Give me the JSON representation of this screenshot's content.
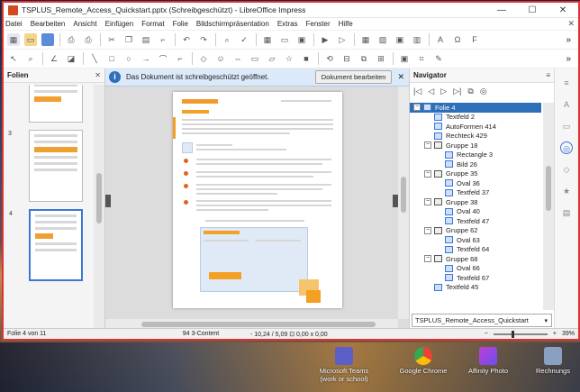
{
  "window": {
    "title": "TSPLUS_Remote_Access_Quickstart.pptx (Schreibgeschützt) - LibreOffice Impress",
    "minimize": "—",
    "maximize": "☐",
    "close": "✕"
  },
  "menu": [
    "Datei",
    "Bearbeiten",
    "Ansicht",
    "Einfügen",
    "Format",
    "Folie",
    "Bildschirmpräsentation",
    "Extras",
    "Fenster",
    "Hilfe"
  ],
  "slides_pane": {
    "title": "Folien",
    "close": "✕",
    "thumb_numbers": [
      "",
      "3",
      "4"
    ]
  },
  "infobar": {
    "icon": "i",
    "message": "Das Dokument ist schreibgeschützt geöffnet.",
    "button": "Dokument bearbeiten",
    "close": "✕"
  },
  "navigator": {
    "title": "Navigator",
    "close": "✕",
    "menu": "≡",
    "tree": [
      {
        "label": "Folie 4",
        "level": 0,
        "expand": "−",
        "selected": true,
        "kind": "slide"
      },
      {
        "label": "Textfeld 2",
        "level": 1,
        "kind": "shape"
      },
      {
        "label": "AutoFormen 414",
        "level": 1,
        "kind": "shape"
      },
      {
        "label": "Rechteck 429",
        "level": 1,
        "kind": "shape"
      },
      {
        "label": "Gruppe 18",
        "level": 1,
        "expand": "−",
        "kind": "group"
      },
      {
        "label": "Rectangle 3",
        "level": 2,
        "kind": "shape"
      },
      {
        "label": "Bild 26",
        "level": 2,
        "kind": "shape"
      },
      {
        "label": "Gruppe 35",
        "level": 1,
        "expand": "−",
        "kind": "group"
      },
      {
        "label": "Oval 36",
        "level": 2,
        "kind": "shape"
      },
      {
        "label": "Textfeld 37",
        "level": 2,
        "kind": "shape"
      },
      {
        "label": "Gruppe 38",
        "level": 1,
        "expand": "−",
        "kind": "group"
      },
      {
        "label": "Oval 40",
        "level": 2,
        "kind": "shape"
      },
      {
        "label": "Textfeld 47",
        "level": 2,
        "kind": "shape"
      },
      {
        "label": "Gruppe 62",
        "level": 1,
        "expand": "−",
        "kind": "group"
      },
      {
        "label": "Oval 63",
        "level": 2,
        "kind": "shape"
      },
      {
        "label": "Textfeld 64",
        "level": 2,
        "kind": "shape"
      },
      {
        "label": "Gruppe 68",
        "level": 1,
        "expand": "−",
        "kind": "group"
      },
      {
        "label": "Oval 66",
        "level": 2,
        "kind": "shape"
      },
      {
        "label": "Textfeld 67",
        "level": 2,
        "kind": "shape"
      },
      {
        "label": "Textfeld 45",
        "level": 1,
        "kind": "shape"
      }
    ],
    "document_select": "TSPLUS_Remote_Access_Quickstart"
  },
  "statusbar": {
    "slide": "Folie 4 von 11",
    "layout": "94 3-Content",
    "position": "- 10,24 / 5,09",
    "size": "0,00 x 0,00",
    "zoom": "39%"
  },
  "desktop_icons": [
    "Microsoft Teams (work or school)",
    "Google Chrome",
    "Affinity Photo",
    "Rechnungs"
  ]
}
